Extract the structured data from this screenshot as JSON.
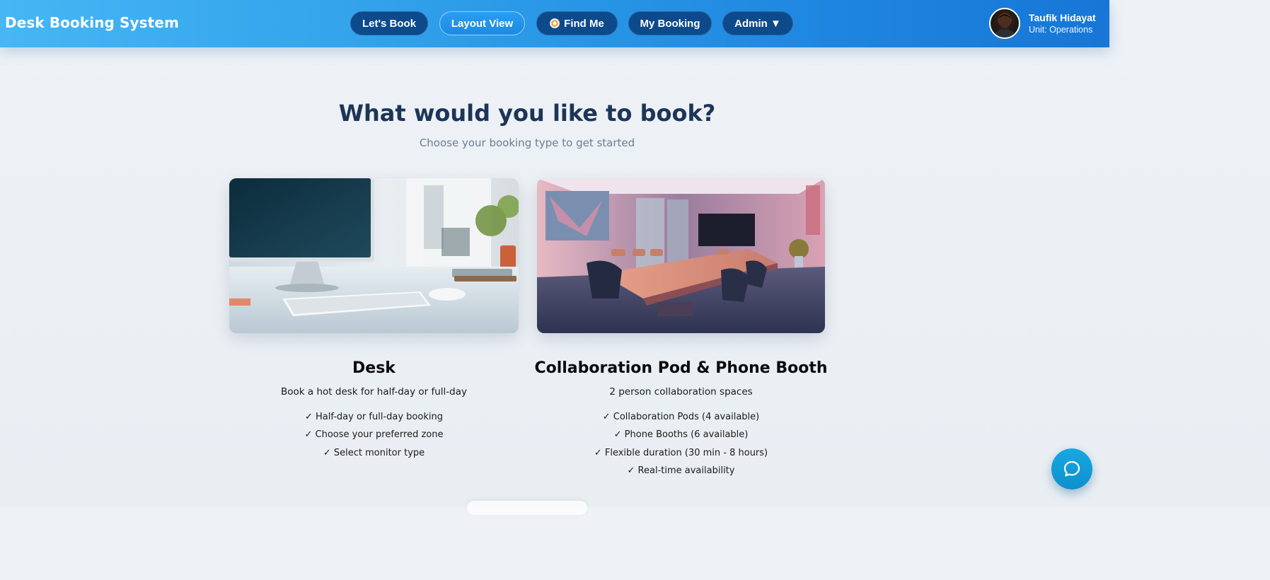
{
  "app": {
    "title": "Desk Booking System"
  },
  "nav": {
    "items": [
      {
        "label": "Let's Book"
      },
      {
        "label": "Layout View",
        "active": true
      },
      {
        "label": "Find Me",
        "icon": "compass-icon"
      },
      {
        "label": "My Booking"
      },
      {
        "label": "Admin ▼"
      }
    ]
  },
  "user": {
    "name": "Taufik Hidayat",
    "unit": "Unit: Operations"
  },
  "page": {
    "heading": "What would you like to book?",
    "subheading": "Choose your booking type to get started"
  },
  "cards": [
    {
      "title": "Desk",
      "description": "Book a hot desk for half-day or full-day",
      "features": [
        "✓ Half-day or full-day booking",
        "✓ Choose your preferred zone",
        "✓ Select monitor type"
      ],
      "image": "desk-workspace-photo"
    },
    {
      "title": "Collaboration Pod & Phone Booth",
      "description": "2 person collaboration spaces",
      "features": [
        "✓ Collaboration Pods (4 available)",
        "✓ Phone Booths (6 available)",
        "✓ Flexible duration (30 min - 8 hours)",
        "✓ Real-time availability"
      ],
      "image": "meeting-room-photo"
    }
  ],
  "chat": {
    "icon": "chat-bubble-icon"
  },
  "colors": {
    "header_start": "#46b6f4",
    "header_end": "#1776d6",
    "nav_button": "#0d4a8c",
    "nav_active": "#2a9ef0",
    "heading": "#1c3558",
    "chat_button": "#18a8e0"
  }
}
